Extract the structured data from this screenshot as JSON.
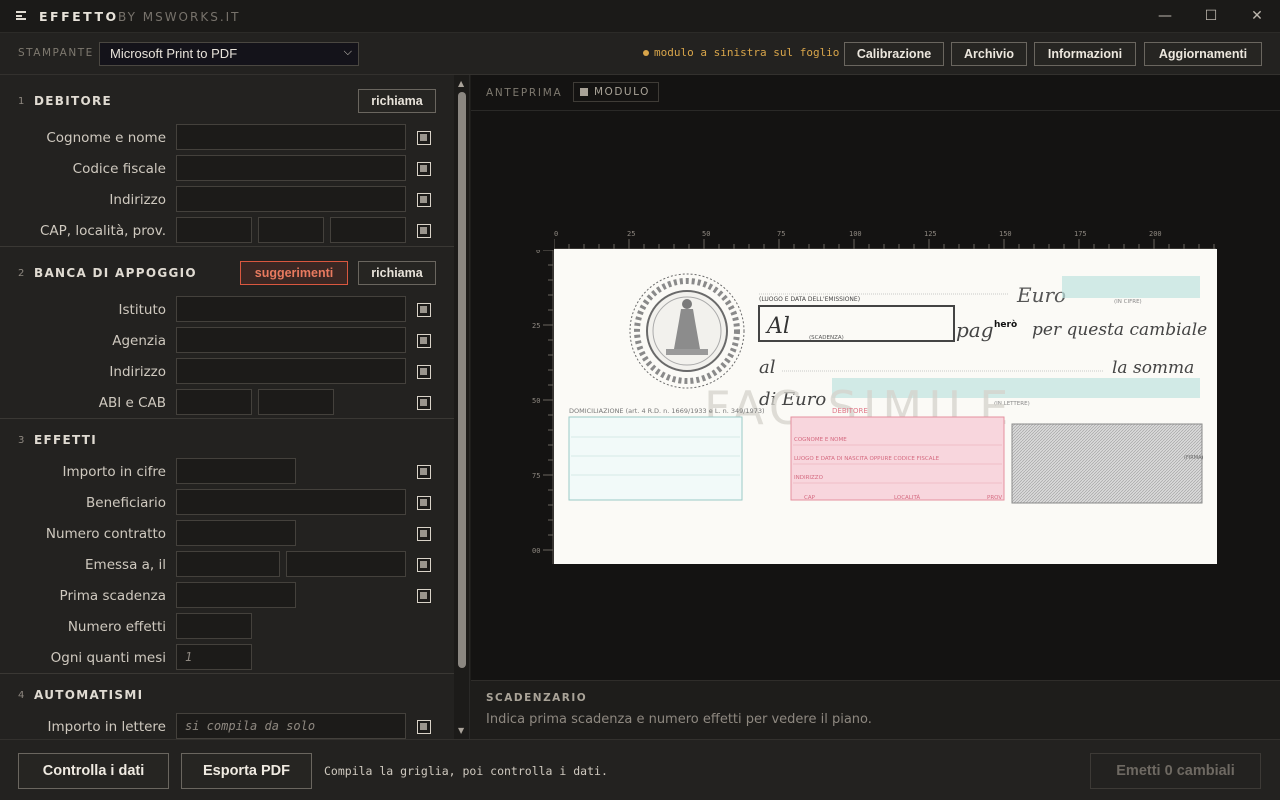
{
  "app": {
    "title": "EFFETTO",
    "subtitle": "BY MSWORKS.IT",
    "window_controls": {
      "minimize": "—",
      "maximize": "☐",
      "close": "✕"
    }
  },
  "toolbar": {
    "printer_label": "STAMPANTE",
    "printer_value": "Microsoft Print to PDF",
    "status": "modulo a sinistra sul foglio",
    "status_color": "#d8a54a",
    "buttons": [
      "Calibrazione",
      "Archivio",
      "Informazioni",
      "Aggiornamenti"
    ]
  },
  "sections": {
    "debitore": {
      "num": "1",
      "title": "DEBITORE",
      "button": "richiama",
      "fields": [
        "Cognome e nome",
        "Codice fiscale",
        "Indirizzo",
        "CAP, località, prov."
      ]
    },
    "banca": {
      "num": "2",
      "title": "BANCA DI APPOGGIO",
      "suggest_button": "suggerimenti",
      "button": "richiama",
      "fields": [
        "Istituto",
        "Agenzia",
        "Indirizzo",
        "ABI e CAB"
      ]
    },
    "effetti": {
      "num": "3",
      "title": "EFFETTI",
      "fields": [
        "Importo in cifre",
        "Beneficiario",
        "Numero contratto",
        "Emessa a, il",
        "Prima scadenza",
        "Numero effetti",
        "Ogni quanti mesi"
      ],
      "ogni_quanti_mesi_placeholder": "1"
    },
    "automatismi": {
      "num": "4",
      "title": "AUTOMATISMI",
      "fields": [
        "Importo in lettere"
      ],
      "importo_lettere_placeholder": "si compila da solo"
    }
  },
  "preview": {
    "label": "ANTEPRIMA",
    "tag": "MODULO",
    "ruler_h": [
      "0",
      "25",
      "50",
      "75",
      "100",
      "125",
      "150",
      "175",
      "200"
    ],
    "ruler_v": [
      "0",
      "25",
      "50",
      "75",
      "00"
    ],
    "cheque": {
      "luogo_data": "(LUOGO E DATA DELL'EMISSIONE)",
      "euro": "Euro",
      "in_cifre": "(IN CIFRE)",
      "al": "Al",
      "scadenza": "(SCADENZA)",
      "pag": "pag",
      "hero": "herò",
      "per_questa": "per questa cambiale",
      "al2": "al",
      "la_somma": "la somma",
      "di_euro": "di Euro",
      "in_lettere": "(IN LETTERE)",
      "fac_simile": "FAC SIMILE",
      "domiciliazione": "DOMICILIAZIONE (art. 4 R.D. n. 1669/1933 e L. n. 349/1973)",
      "debitore": "DEBITORE",
      "cognome_nome": "COGNOME E NOME",
      "luogo_nascita": "LUOGO E DATA DI NASCITA OPPURE CODICE FISCALE",
      "indirizzo": "INDIRIZZO",
      "cap": "CAP",
      "localita": "LOCALITÀ",
      "prov": "PROV",
      "firma": "(FIRMA)"
    }
  },
  "scadenzario": {
    "title": "SCADENZARIO",
    "message": "Indica prima scadenza e numero effetti per vedere il piano."
  },
  "footer": {
    "check_button": "Controlla i dati",
    "export_button": "Esporta PDF",
    "hint": "Compila la griglia, poi controlla i dati.",
    "emit_button": "Emetti 0 cambiali"
  }
}
